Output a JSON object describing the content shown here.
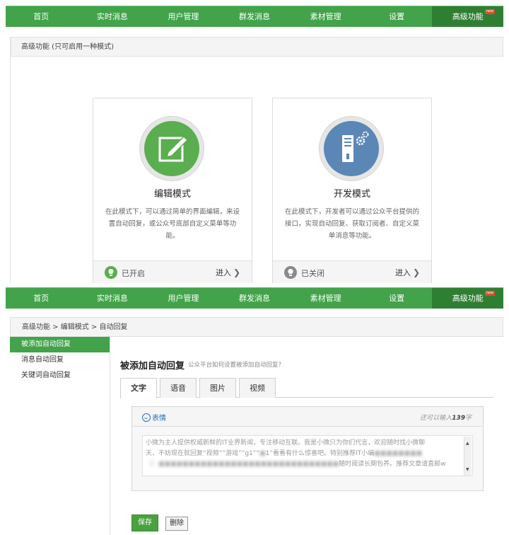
{
  "nav": {
    "items": [
      "首页",
      "实时消息",
      "用户管理",
      "群发消息",
      "素材管理",
      "设置",
      "高级功能"
    ],
    "new_badge": "new"
  },
  "top_panel": {
    "header": "高级功能 (只可启用一种模式)",
    "cards": [
      {
        "title": "编辑模式",
        "description": "在此模式下，可以通过简单的界面编辑，来设置自动回复，或公众号底部自定义菜单等功能。",
        "status": "已开启",
        "action": "进入"
      },
      {
        "title": "开发模式",
        "description": "在此模式下，开发者可以通过公众平台提供的接口，实现自动回复、获取订阅者、自定义菜单消息等功能。",
        "status": "已关闭",
        "action": "进入"
      }
    ]
  },
  "bottom_panel": {
    "breadcrumb": "高级功能 > 编辑模式 > 自动回复",
    "sidebar": [
      "被添加自动回复",
      "消息自动回复",
      "关键词自动回复"
    ],
    "section_title": "被添加自动回复",
    "section_help": "公众平台如何设置被添加自动回复？",
    "tabs": [
      "文字",
      "语音",
      "图片",
      "视频"
    ],
    "editor": {
      "emoji_label": "表情",
      "count_prefix": "还可以输入",
      "count_value": "139",
      "count_suffix": "字",
      "text_line1": "小微为主人提供权威新鲜的IT业界新闻，专注移动互联。我是小微只为你们代言，欢迎随时找小微聊",
      "text_line2": "天，不妨现在就回复“视频”“游戏”“g1”“",
      "text_line2b": "1”看看有什么惊喜吧。特别推荐IT小编",
      "text_line3": "随时阅读长期包养。推荐文章请直邮w"
    },
    "buttons": {
      "save": "保存",
      "delete": "删除"
    }
  }
}
